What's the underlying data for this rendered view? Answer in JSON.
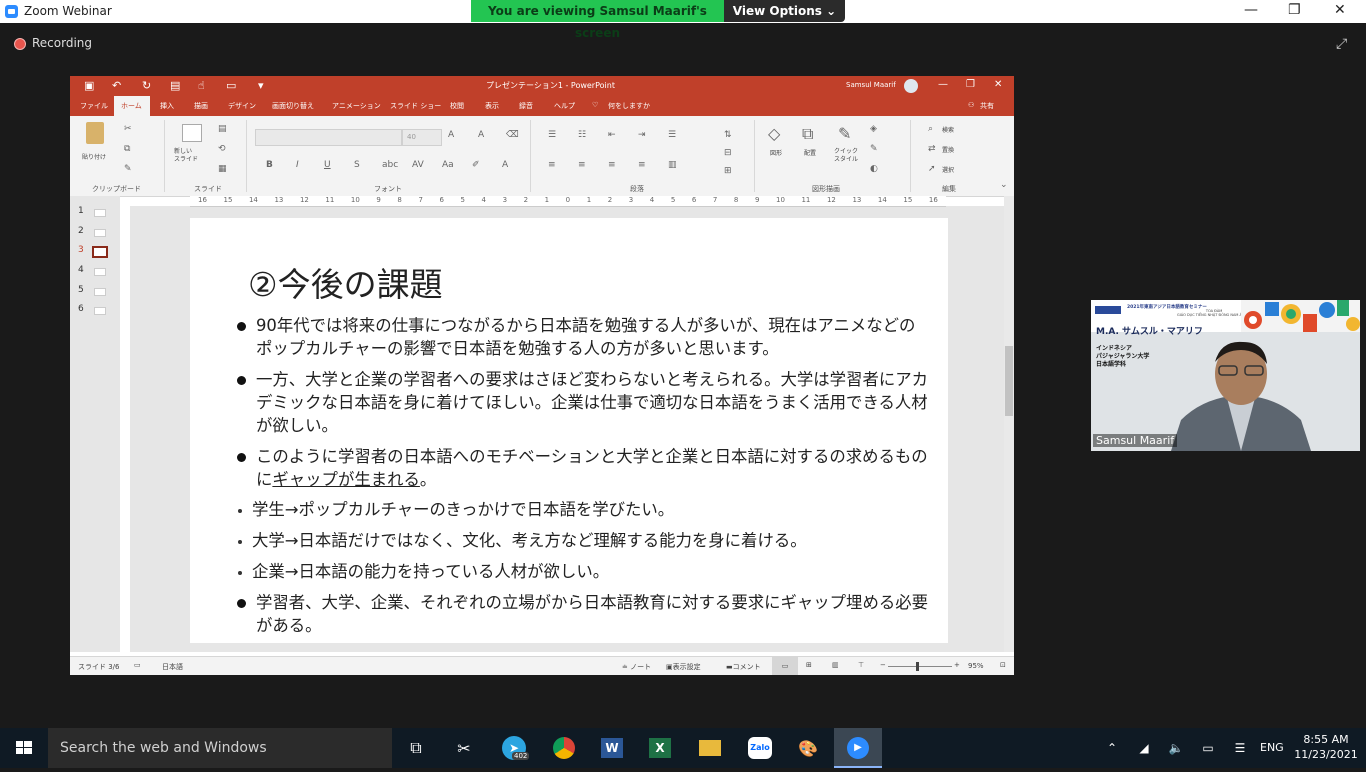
{
  "zoom": {
    "window_title": "Zoom Webinar",
    "viewing_banner": "You are viewing Samsul Maarif's screen",
    "view_options": "View Options",
    "recording": "Recording"
  },
  "ppt": {
    "doc_title": "プレゼンテーション1 - PowerPoint",
    "user": "Samsul Maarif",
    "tabs": [
      "ファイル",
      "ホーム",
      "挿入",
      "描画",
      "デザイン",
      "画面切り替え",
      "アニメーション",
      "スライド ショー",
      "校閲",
      "表示",
      "録音",
      "ヘルプ",
      "何をしますか"
    ],
    "share": "共有",
    "ribbon": {
      "paste": "貼り付け",
      "clipboard": "クリップボード",
      "new_slide": "新しい\nスライド",
      "slides": "スライド",
      "font_size": "40",
      "font": "フォント",
      "paragraph": "段落",
      "shape": "図形",
      "arrange": "配置",
      "quick_style": "クイック\nスタイル",
      "drawing": "図形描画",
      "find": "検索",
      "replace": "置換",
      "select": "選択",
      "editing": "編集"
    },
    "ruler_h": [
      "16",
      "15",
      "14",
      "13",
      "12",
      "11",
      "10",
      "9",
      "8",
      "7",
      "6",
      "5",
      "4",
      "3",
      "2",
      "1",
      "0",
      "1",
      "2",
      "3",
      "4",
      "5",
      "6",
      "7",
      "8",
      "9",
      "10",
      "11",
      "12",
      "13",
      "14",
      "15",
      "16"
    ],
    "thumbs": [
      "1",
      "2",
      "3",
      "4",
      "5",
      "6"
    ],
    "slide": {
      "title": "②今後の課題",
      "b1": "90年代では将来の仕事につながるから日本語を勉強する人が多いが、現在はアニメなどのポップカルチャーの影響で日本語を勉強する人の方が多いと思います。",
      "b2": "一方、大学と企業の学習者への要求はさほど変わらないと考えられる。大学は学習者にアカデミックな日本語を身に着けてほしい。企業は仕事で適切な日本語をうまく活用できる人材が欲しい。",
      "b3a": "このように学習者の日本語へのモチベーションと大学と企業と日本語に対するの求めるものに",
      "b3u": "ギャップが生まれる",
      "b3b": "。",
      "s1": "学生→ポップカルチャーのきっかけで日本語を学びたい。",
      "s2": "大学→日本語だけではなく、文化、考え方など理解する能力を身に着ける。",
      "s3": "企業→日本語の能力を持っている人材が欲しい。",
      "b4": "学習者、大学、企業、それぞれの立場がから日本語教育に対する要求にギャップ埋める必要がある。"
    },
    "status": {
      "slide_count": "スライド 3/6",
      "language": "日本語",
      "notes": "ノート",
      "display_settings": "表示設定",
      "comments": "コメント",
      "zoom": "95%"
    }
  },
  "webcam": {
    "banner_small": "2021年東南アジア日本語教育セミナー",
    "banner_vn": "TOA ĐÀM\nGIÁO DỤC TIẾNG NHẬT ĐÔNG NAM Á NĂM",
    "name": "M.A. サムスル・マアリフ",
    "affil1": "インドネシア",
    "affil2": "パジャジャラン大学",
    "affil3": "日本語学科",
    "label": "Samsul Maarif"
  },
  "taskbar": {
    "search": "Search the web and Windows",
    "telegram_badge": "402",
    "lang": "ENG",
    "time": "8:55 AM",
    "date": "11/23/2021"
  }
}
